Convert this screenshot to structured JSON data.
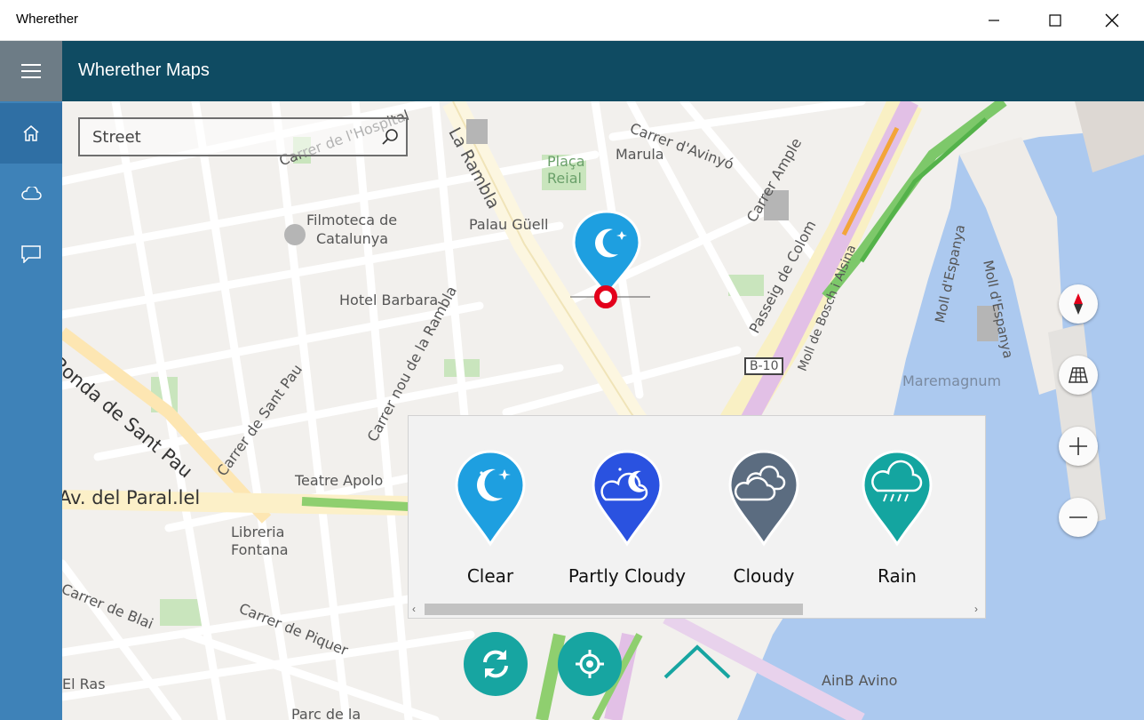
{
  "window": {
    "title": "Wherether",
    "minimize_label": "Minimize",
    "maximize_label": "Maximize",
    "close_label": "Close"
  },
  "header": {
    "title": "Wherether Maps"
  },
  "rail": {
    "items": [
      {
        "icon": "home-icon",
        "active": true
      },
      {
        "icon": "cloud-icon",
        "active": false
      },
      {
        "icon": "chat-icon",
        "active": false
      }
    ]
  },
  "search": {
    "placeholder": "Street"
  },
  "map": {
    "labels": [
      "Carrer de l'Hospital",
      "La Rambla",
      "Carrer d'Avinyó",
      "Marula",
      "Plaça Reial",
      "Carrer Ample",
      "Filmoteca de",
      "Catalunya",
      "Palau Güell",
      "Passeig de Colom",
      "Moll de Bosch i Alsina",
      "Moll d'Espanya",
      "Moll d'Espanya",
      "Hotel Barbara",
      "Carrer nou de la Rambla",
      "Ronda de Sant Pau",
      "Carrer de Sant Pau",
      "B-10",
      "Maremagnum",
      "Av. del Paral.lel",
      "Teatre Apolo",
      "Libreria",
      "Fontana",
      "Carrer de Blai",
      "Carrer de Piquer",
      "AinB Avino",
      "El Ras",
      "Parc de la"
    ]
  },
  "weather_options": [
    {
      "label": "Clear",
      "icon": "moon-stars-icon",
      "color": "#1e9fe0"
    },
    {
      "label": "Partly Cloudy",
      "icon": "cloud-moon-icon",
      "color": "#2a52e0"
    },
    {
      "label": "Cloudy",
      "icon": "cloud-icon",
      "color": "#5b6c80"
    },
    {
      "label": "Rain",
      "icon": "rain-cloud-icon",
      "color": "#14a5a0"
    }
  ],
  "colors": {
    "titlebar": "#ffffff",
    "header": "#0f4b62",
    "rail": "#3e82b8",
    "accent": "#17a5a1"
  }
}
